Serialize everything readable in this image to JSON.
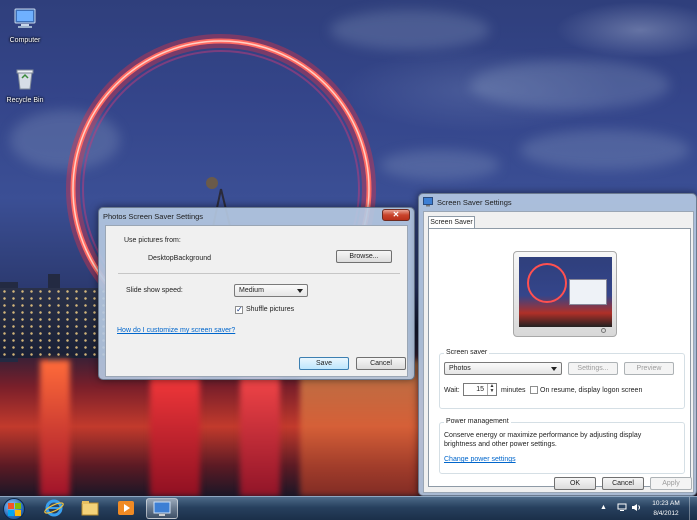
{
  "desktop": {
    "icons": [
      {
        "label": "Computer",
        "icon": "computer-icon"
      },
      {
        "label": "Recycle Bin",
        "icon": "recycle-bin-icon"
      }
    ]
  },
  "photos_dialog": {
    "title": "Photos Screen Saver Settings",
    "use_pictures_label": "Use pictures from:",
    "folder_value": "DesktopBackground",
    "browse_label": "Browse...",
    "speed_label": "Slide show speed:",
    "speed_value": "Medium",
    "shuffle_label": "Shuffle pictures",
    "shuffle_checked": true,
    "help_link": "How do I customize my screen saver?",
    "save_label": "Save",
    "cancel_label": "Cancel"
  },
  "screensaver_dialog": {
    "title": "Screen Saver Settings",
    "tab_label": "Screen Saver",
    "group_label": "Screen saver",
    "saver_value": "Photos",
    "settings_label": "Settings...",
    "preview_label": "Preview",
    "wait_label": "Wait:",
    "wait_value": "15",
    "minutes_label": "minutes",
    "resume_label": "On resume, display logon screen",
    "resume_checked": false,
    "power_group_label": "Power management",
    "power_text_1": "Conserve energy or maximize performance by adjusting display",
    "power_text_2": "brightness and other power settings.",
    "power_link": "Change power settings",
    "ok_label": "OK",
    "cancel_label": "Cancel",
    "apply_label": "Apply"
  },
  "taskbar": {
    "time": "10:23 AM",
    "date": "8/4/2012"
  },
  "colors": {
    "link": "#0066cc",
    "wheel": "#ff4a4a",
    "taskbar": "#27405e"
  }
}
